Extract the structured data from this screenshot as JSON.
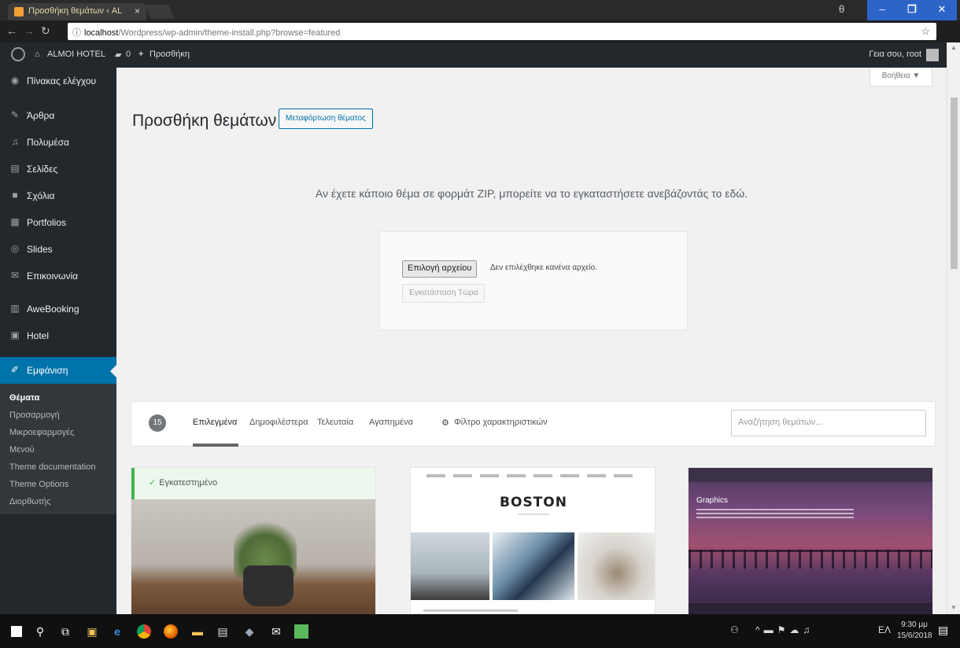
{
  "browser": {
    "tab_title": "Προσθήκη θεμάτων ‹ AL",
    "tab_close": "×",
    "url_host": "localhost",
    "url_path": "/Wordpress/wp-admin/theme-install.php?browse=featured",
    "window_minimize": "–",
    "window_maximize": "❐",
    "window_close": "✕"
  },
  "adminbar": {
    "site_name": "ALMOI HOTEL",
    "comments_count": "0",
    "new_label": "Προσθήκη",
    "howdy": "Γεια σου, root"
  },
  "sidebar": {
    "items": [
      {
        "label": "Πίνακας ελέγχου",
        "icon": "dashboard-icon",
        "glyph": "◉"
      },
      {
        "label": "Άρθρα",
        "icon": "pin-icon",
        "glyph": "✎"
      },
      {
        "label": "Πολυμέσα",
        "icon": "media-icon",
        "glyph": "♫"
      },
      {
        "label": "Σελίδες",
        "icon": "pages-icon",
        "glyph": "▤"
      },
      {
        "label": "Σχόλια",
        "icon": "comments-icon",
        "glyph": "■"
      },
      {
        "label": "Portfolios",
        "icon": "portfolio-icon",
        "glyph": "▦"
      },
      {
        "label": "Slides",
        "icon": "slides-icon",
        "glyph": "◎"
      },
      {
        "label": "Επικοινωνία",
        "icon": "mail-icon",
        "glyph": "✉"
      },
      {
        "label": "AweBooking",
        "icon": "booking-icon",
        "glyph": "▥"
      },
      {
        "label": "Hotel",
        "icon": "hotel-icon",
        "glyph": "▣"
      }
    ],
    "active": {
      "label": "Εμφάνιση",
      "icon": "appearance-icon",
      "glyph": "✐"
    },
    "submenu": [
      "Θέματα",
      "Προσαρμογή",
      "Μικροεφαρμογές",
      "Μενού",
      "Theme documentation",
      "Theme Options",
      "Διορθωτής"
    ]
  },
  "main": {
    "help_label": "Βοήθεια ▼",
    "page_title": "Προσθήκη θεμάτων",
    "upload_button": "Μεταφόρτωση θέματος",
    "upload_desc": "Αν έχετε κάποιο θέμα σε φορμάτ ZIP, μπορείτε να το εγκαταστήσετε ανεβάζοντάς το εδώ.",
    "choose_file": "Επιλογή αρχείου",
    "no_file": "Δεν επιλέχθηκε κανένα αρχείο.",
    "install_now": "Εγκατάσταση Τώρα",
    "theme_count": "15",
    "filters": {
      "featured": "Επιλεγμένα",
      "popular": "Δημοφιλέστερα",
      "latest": "Τελευταία",
      "favorites": "Αγαπημένα",
      "feature_filter": "Φίλτρο χαρακτηριστικών"
    },
    "search_placeholder": "Αναζήτηση θεμάτων...",
    "installed_notice": "Εγκατεστημένο",
    "theme_boston_title": "BOSTON",
    "theme_purple_heading": "Graphics"
  },
  "taskbar": {
    "lang": "ΕΛ",
    "time": "9:30 μμ",
    "date": "15/6/2018"
  },
  "colors": {
    "wp_dark": "#23282d",
    "wp_accent": "#0073aa",
    "installed_green": "#46b450",
    "window_blue": "#2d64c8"
  }
}
